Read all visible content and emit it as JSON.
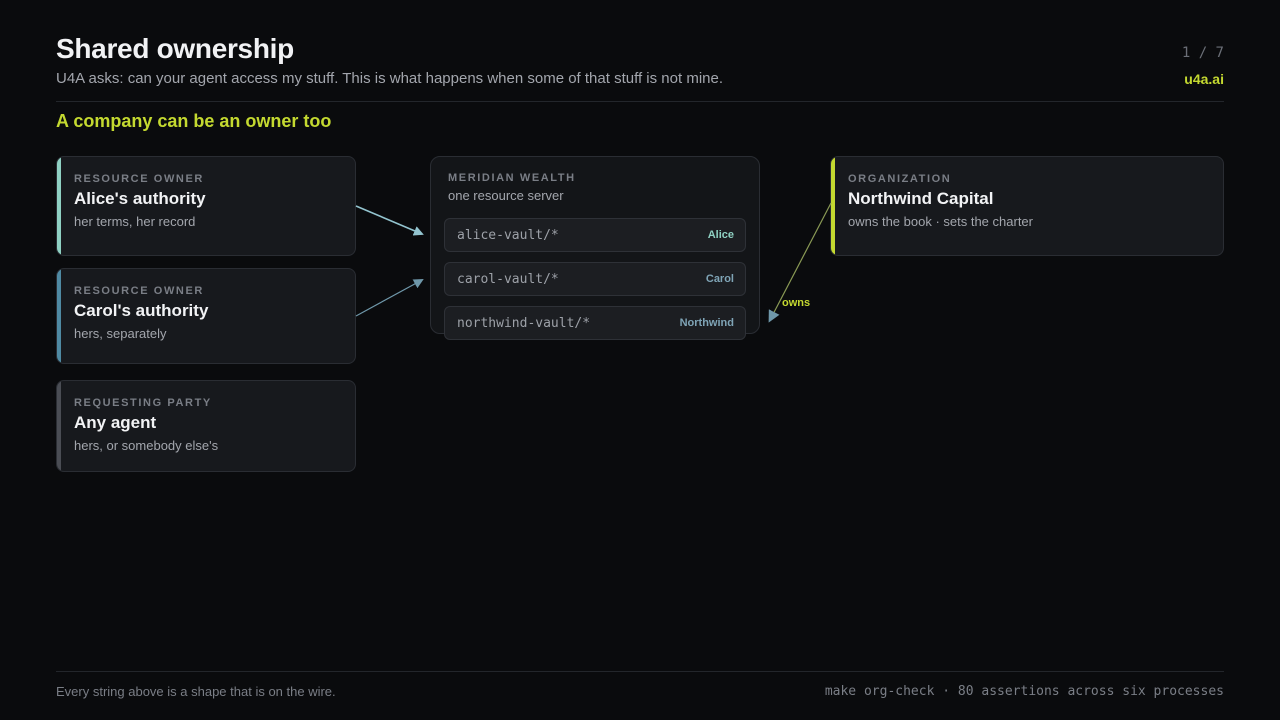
{
  "header": {
    "title": "Shared ownership",
    "subtitle": "U4A asks: can your agent access my stuff. This is what happens when some of that stuff is not mine.",
    "pager": "1 / 7",
    "brand": "u4a.ai"
  },
  "section_title": "A company can be an owner too",
  "cards": [
    {
      "kicker": "RESOURCE OWNER",
      "name": "Alice's authority",
      "desc": "her terms, her record",
      "accent": "#8fd1c3"
    },
    {
      "kicker": "RESOURCE OWNER",
      "name": "Carol's authority",
      "desc": "hers, separately",
      "accent": "#4f8aa3"
    },
    {
      "kicker": "REQUESTING PARTY",
      "name": "Any agent",
      "desc": "hers, or somebody else's",
      "accent": "#4a4d54"
    }
  ],
  "server": {
    "kicker": "MERIDIAN WEALTH",
    "desc": "one resource server",
    "vaults": [
      {
        "path": "alice-vault/*",
        "owner": "Alice",
        "color": "#8fd1c3"
      },
      {
        "path": "carol-vault/*",
        "owner": "Carol",
        "color": "#7fa4b6"
      },
      {
        "path": "northwind-vault/*",
        "owner": "Northwind",
        "color": "#7fa4b6"
      }
    ]
  },
  "organization": {
    "kicker": "ORGANIZATION",
    "name": "Northwind Capital",
    "desc": "owns the book · sets the charter",
    "accent": "#c4d930"
  },
  "edge_label": "owns",
  "footer": {
    "left": "Every string above is a shape that is on the wire.",
    "right": "make org-check · 80 assertions across six processes"
  },
  "colors": {
    "accent": "#c4d930",
    "alice": "#8fd1c3",
    "carol": "#4f8aa3",
    "edge_alice": "#93c4cf",
    "edge_carol": "#6f98aa",
    "edge_owns": "#8a9a55"
  }
}
